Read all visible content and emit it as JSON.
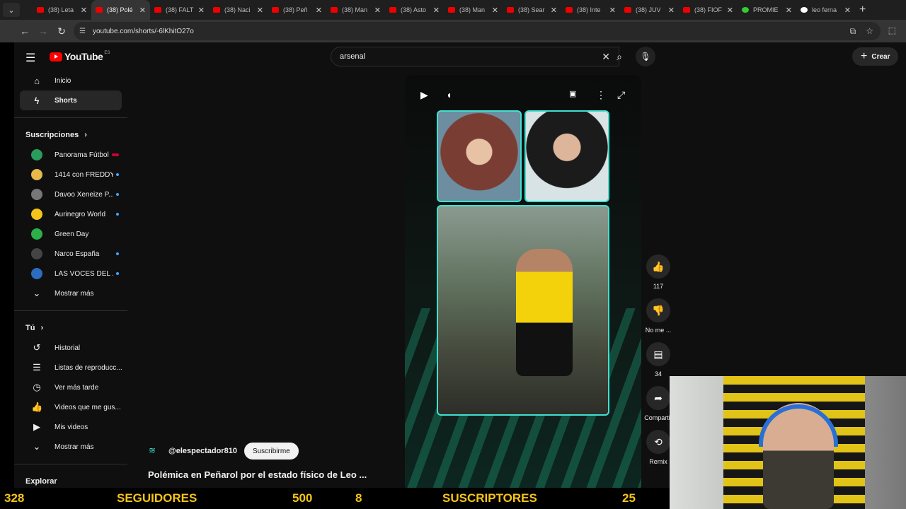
{
  "browser": {
    "tabs": [
      {
        "label": "(38) Leta",
        "active": false
      },
      {
        "label": "(38) Polé",
        "active": true
      },
      {
        "label": "(38) FALT",
        "active": false
      },
      {
        "label": "(38) Naci",
        "active": false
      },
      {
        "label": "(38) Peñ",
        "active": false
      },
      {
        "label": "(38) Man",
        "active": false
      },
      {
        "label": "(38) Asto",
        "active": false
      },
      {
        "label": "(38) Man",
        "active": false
      },
      {
        "label": "(38) Sear",
        "active": false
      },
      {
        "label": "(38) Inte",
        "active": false
      },
      {
        "label": "(38) JUV",
        "active": false
      },
      {
        "label": "(38) FIOF",
        "active": false
      },
      {
        "label": "PROMIE",
        "active": false
      },
      {
        "label": "leo ferna",
        "active": false
      }
    ],
    "url": "youtube.com/shorts/-6lKhitO27o"
  },
  "header": {
    "logo_text": "YouTube",
    "logo_region": "ES",
    "search_value": "arsenal",
    "create_label": "Crear"
  },
  "sidebar": {
    "top": [
      {
        "label": "Inicio",
        "icon": "home-icon"
      },
      {
        "label": "Shorts",
        "icon": "shorts-icon"
      }
    ],
    "subs_title": "Suscripciones",
    "subs": [
      {
        "label": "Panorama Fútbol",
        "badge": "live",
        "color": "#2a9d5c"
      },
      {
        "label": "1414 con FREDDY",
        "badge": "dot",
        "color": "#e8b84a"
      },
      {
        "label": "Davoo Xeneize P...",
        "badge": "dot",
        "color": "#777777"
      },
      {
        "label": "Aurinegro World",
        "badge": "dot",
        "color": "#f4c518"
      },
      {
        "label": "Green Day",
        "badge": "",
        "color": "#2bb04a"
      },
      {
        "label": "Narco España",
        "badge": "dot",
        "color": "#444444"
      },
      {
        "label": "LAS VOCES DEL ...",
        "badge": "dot",
        "color": "#2d6cc0"
      }
    ],
    "subs_more": "Mostrar más",
    "you_title": "Tú",
    "you": [
      {
        "label": "Historial",
        "icon": "history-icon"
      },
      {
        "label": "Listas de reproducc...",
        "icon": "playlists-icon"
      },
      {
        "label": "Ver más tarde",
        "icon": "watch-later-icon"
      },
      {
        "label": "Videos que me gus...",
        "icon": "liked-videos-icon"
      },
      {
        "label": "Mis videos",
        "icon": "my-videos-icon"
      }
    ],
    "you_more": "Mostrar más",
    "explore": "Explorar"
  },
  "short": {
    "likes": "117",
    "dislike_label": "No me ...",
    "comments": "34",
    "share_label": "Compartir",
    "remix_label": "Remix",
    "channel": "@elespectador810",
    "subscribe_label": "Suscribirme",
    "title": "Polémica en Peñarol por el estado físico de Leo ..."
  },
  "ticker": {
    "followers_count": "328",
    "followers_label": "SEGUIDORES",
    "followers_goal": "500",
    "subs_count": "8",
    "subs_label": "SUSCRIPTORES",
    "subs_goal": "25"
  },
  "colors": {
    "accent": "#40e0d0",
    "yt_red": "#ff0000",
    "ticker": "#f5c518"
  }
}
